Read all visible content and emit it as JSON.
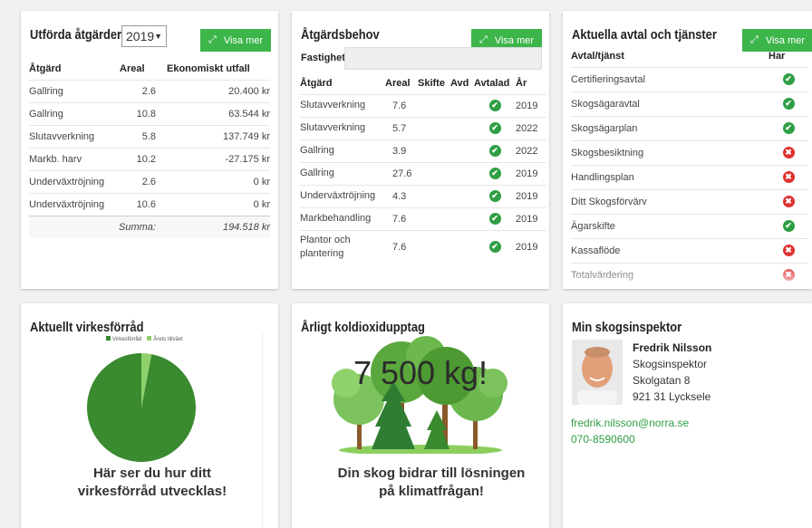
{
  "card1": {
    "title": "Utförda åtgärder",
    "year": "2019",
    "button": "Visa mer",
    "headers": [
      "Åtgärd",
      "Areal",
      "Ekonomiskt utfall"
    ],
    "rows": [
      [
        "Gallring",
        "2.6",
        "20.400 kr"
      ],
      [
        "Gallring",
        "10.8",
        "63.544 kr"
      ],
      [
        "Slutavverkning",
        "5.8",
        "137.749 kr"
      ],
      [
        "Markb. harv",
        "10.2",
        "-27.175 kr"
      ],
      [
        "Underväxtröjning",
        "2.6",
        "0 kr"
      ],
      [
        "Underväxtröjning",
        "10.6",
        "0 kr"
      ]
    ],
    "sum_label": "Summa:",
    "sum_value": "194.518 kr"
  },
  "card2": {
    "title": "Åtgärdsbehov",
    "button": "Visa mer",
    "filter_label": "Fastighet",
    "filter_value": "",
    "headers": [
      "Åtgärd",
      "Areal",
      "Skifte",
      "Avd",
      "Avtalad",
      "År"
    ],
    "rows": [
      {
        "name": "Slutavverkning",
        "areal": "7.6",
        "agreed": true,
        "year": "2019"
      },
      {
        "name": "Slutavverkning",
        "areal": "5.7",
        "agreed": true,
        "year": "2022"
      },
      {
        "name": "Gallring",
        "areal": "3.9",
        "agreed": true,
        "year": "2022"
      },
      {
        "name": "Gallring",
        "areal": "27.6",
        "agreed": true,
        "year": "2019"
      },
      {
        "name": "Underväxtröjning",
        "areal": "4.3",
        "agreed": true,
        "year": "2019"
      },
      {
        "name": "Markbehandling",
        "areal": "7.6",
        "agreed": true,
        "year": "2019"
      },
      {
        "name": "Plantor och plantering",
        "areal": "7.6",
        "agreed": true,
        "year": "2019"
      }
    ]
  },
  "card3": {
    "title": "Aktuella avtal och tjänster",
    "button": "Visa mer",
    "headers": [
      "Avtal/tjänst",
      "Har"
    ],
    "rows": [
      {
        "name": "Certifieringsavtal",
        "has": true
      },
      {
        "name": "Skogsägaravtal",
        "has": true
      },
      {
        "name": "Skogsägarplan",
        "has": true
      },
      {
        "name": "Skogsbesiktning",
        "has": false
      },
      {
        "name": "Handlingsplan",
        "has": false
      },
      {
        "name": "Ditt Skogsförvärv",
        "has": false
      },
      {
        "name": "Ägarskifte",
        "has": true
      },
      {
        "name": "Kassaflöde",
        "has": false
      },
      {
        "name": "Totalvärdering",
        "has": false
      }
    ]
  },
  "card4": {
    "title": "Aktuellt virkesförråd",
    "caption": "Här ser du hur ditt virkesförråd utvecklas!"
  },
  "chart_data": {
    "type": "pie",
    "categories": [
      "Virkesförråd",
      "Årets tillväxt"
    ],
    "values": [
      97,
      3
    ],
    "colors": [
      "#3a8a2f",
      "#8fd16b"
    ],
    "legend": "top"
  },
  "card5": {
    "title": "Årligt koldioxidupptag",
    "big_value": "7 500 kg!",
    "caption": "Din skog bidrar till lösningen på klimatfrågan!"
  },
  "card6": {
    "title": "Min skogsinspektor",
    "name": "Fredrik Nilsson",
    "role": "Skogsinspektor",
    "address": "Skolgatan 8",
    "city": "921 31 Lycksele",
    "email": "fredrik.nilsson@norra.se",
    "phone": "070-8590600"
  },
  "colors": {
    "accent": "#3cb54a",
    "check": "#2f9e44",
    "cross": "#e03131"
  }
}
